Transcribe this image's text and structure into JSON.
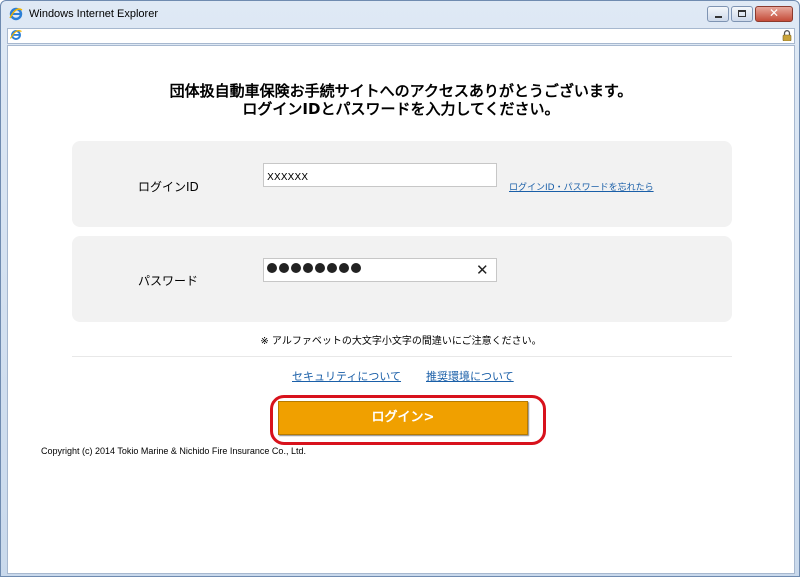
{
  "window": {
    "title": "Windows Internet Explorer",
    "icons": {
      "app": "ie-logo-icon",
      "address": "ie-page-icon",
      "lock": "lock-icon"
    },
    "controls": [
      "minimize-button",
      "maximize-button",
      "close-button"
    ]
  },
  "page": {
    "headline_line1": "団体扱自動車保険お手続サイトへのアクセスありがとうございます。",
    "headline_line2": "ログインIDとパスワードを入力してください。",
    "login_id": {
      "label": "ログインID",
      "value": "XXXXXX",
      "forgot_link": "ログインID・パスワードを忘れたら"
    },
    "password": {
      "label": "パスワード",
      "masked_length": 8,
      "clear_icon": "close-x-icon"
    },
    "note": "※ アルファベットの大文字小文字の間違いにご注意ください。",
    "links": {
      "security": "セキュリティについて",
      "environment": "推奨環境について"
    },
    "login_button": "ログイン>",
    "copyright": "Copyright (c) 2014 Tokio Marine & Nichido Fire Insurance Co., Ltd."
  },
  "colors": {
    "accent_button": "#f0a000",
    "highlight": "#d8121c",
    "link": "#1a5fa8",
    "panel_bg": "#f2f2f2"
  }
}
